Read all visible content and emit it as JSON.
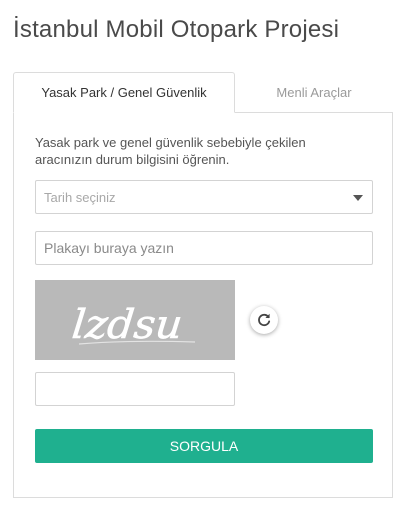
{
  "page": {
    "title": "İstanbul Mobil Otopark Projesi"
  },
  "tabs": [
    {
      "label": "Yasak Park / Genel Güvenlik",
      "active": true
    },
    {
      "label": "Menli Araçlar",
      "active": false
    }
  ],
  "form": {
    "description": "Yasak park ve genel güvenlik sebebiyle çekilen aracınızın durum bilgisini öğrenin.",
    "date_select": {
      "placeholder": "Tarih seçiniz",
      "icon": "caret-down-icon"
    },
    "plate_input": {
      "placeholder": "Plakayı buraya yazın",
      "value": ""
    },
    "captcha": {
      "text": "lzdsu",
      "refresh_icon": "refresh-icon"
    },
    "captcha_input": {
      "value": "",
      "placeholder": ""
    },
    "submit_label": "SORGULA"
  },
  "colors": {
    "accent": "#1fb08f",
    "title": "#4a4a4a",
    "captcha_bg": "#b9b9b9"
  }
}
